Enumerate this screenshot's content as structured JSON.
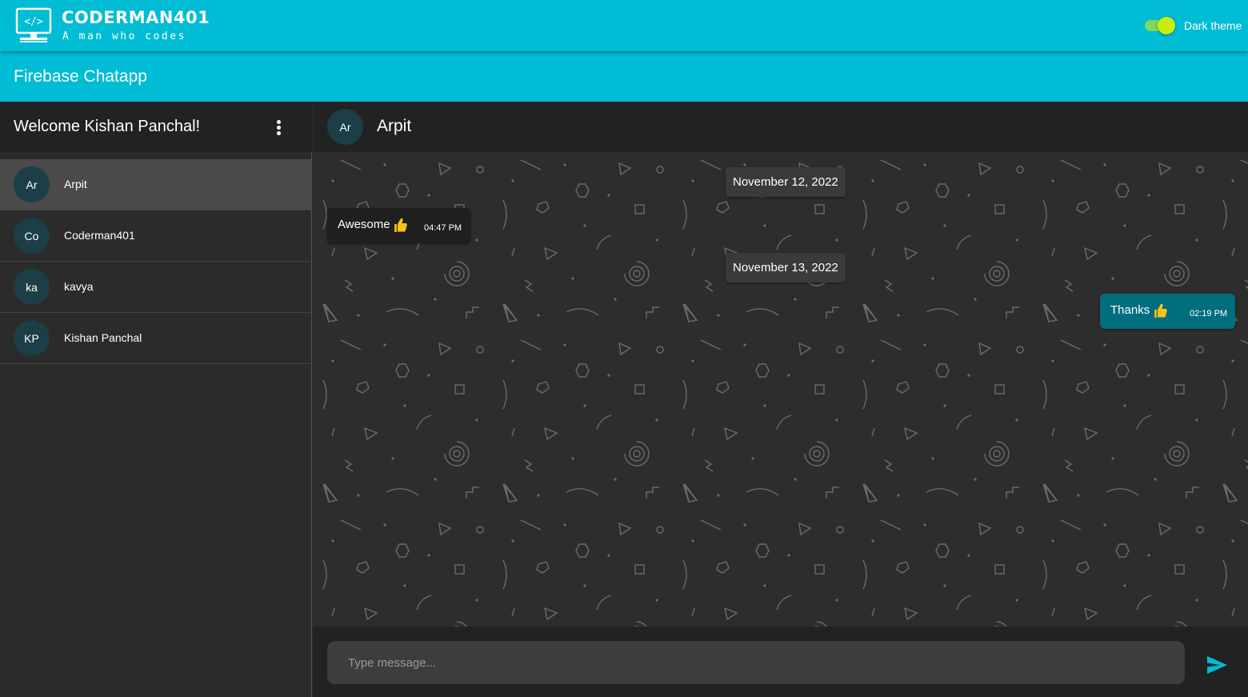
{
  "header": {
    "brand_name": "CODERMAN401",
    "brand_tagline": "A man who codes",
    "theme_toggle": {
      "label": "Dark theme",
      "on": true
    }
  },
  "app": {
    "title": "Firebase Chatapp"
  },
  "sidebar": {
    "welcome": "Welcome Kishan Panchal!",
    "contacts": [
      {
        "initials": "Ar",
        "name": "Arpit",
        "active": true
      },
      {
        "initials": "Co",
        "name": "Coderman401",
        "active": false
      },
      {
        "initials": "ka",
        "name": "kavya",
        "active": false
      },
      {
        "initials": "KP",
        "name": "Kishan Panchal",
        "active": false
      }
    ]
  },
  "chat": {
    "avatar": "Ar",
    "name": "Arpit",
    "dates": [
      "November 12, 2022",
      "November 13, 2022"
    ],
    "messages": [
      {
        "text": "Awesome",
        "emoji": "thumbs-up",
        "time": "04:47 PM",
        "direction": "incoming"
      },
      {
        "text": "Thanks",
        "emoji": "thumbs-up",
        "time": "02:19 PM",
        "direction": "outgoing"
      }
    ]
  },
  "composer": {
    "placeholder": "Type message..."
  },
  "icons": {
    "menu": "more-vert-icon",
    "send": "send-icon",
    "logo": "code-monitor-icon"
  },
  "colors": {
    "primary": "#00bcd4",
    "outgoing_bubble": "#006e7f",
    "toggle": "#c6ef0e"
  }
}
